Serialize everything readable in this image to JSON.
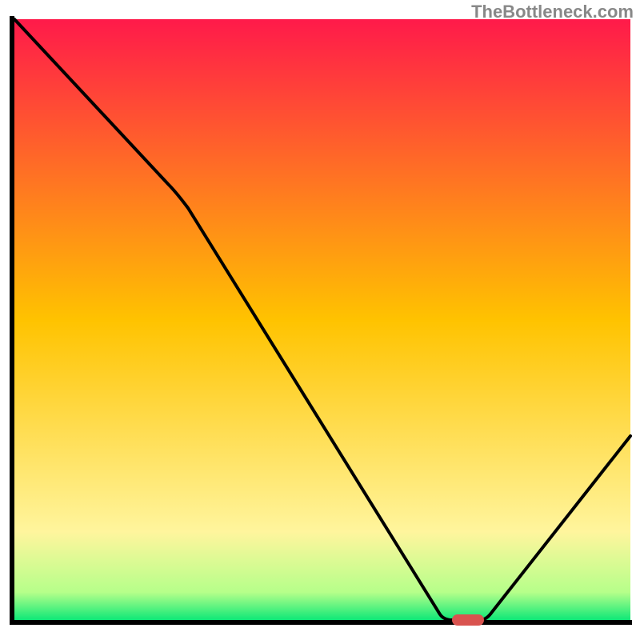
{
  "watermark": "TheBottleneck.com",
  "chart_data": {
    "type": "line",
    "title": "",
    "xlabel": "",
    "ylabel": "",
    "xlim": [
      0,
      100
    ],
    "ylim": [
      0,
      100
    ],
    "x": [
      0,
      25,
      68,
      72,
      75,
      100
    ],
    "values": [
      100,
      72,
      0,
      0,
      0,
      30
    ],
    "optimal_marker": {
      "x_start": 72,
      "x_end": 76,
      "color": "#d9534f"
    },
    "gradient_stops": [
      {
        "offset": 0,
        "color": "#ff1a4a"
      },
      {
        "offset": 50,
        "color": "#ffc300"
      },
      {
        "offset": 85,
        "color": "#fff59d"
      },
      {
        "offset": 95,
        "color": "#b6ff8a"
      },
      {
        "offset": 100,
        "color": "#00e676"
      }
    ]
  }
}
